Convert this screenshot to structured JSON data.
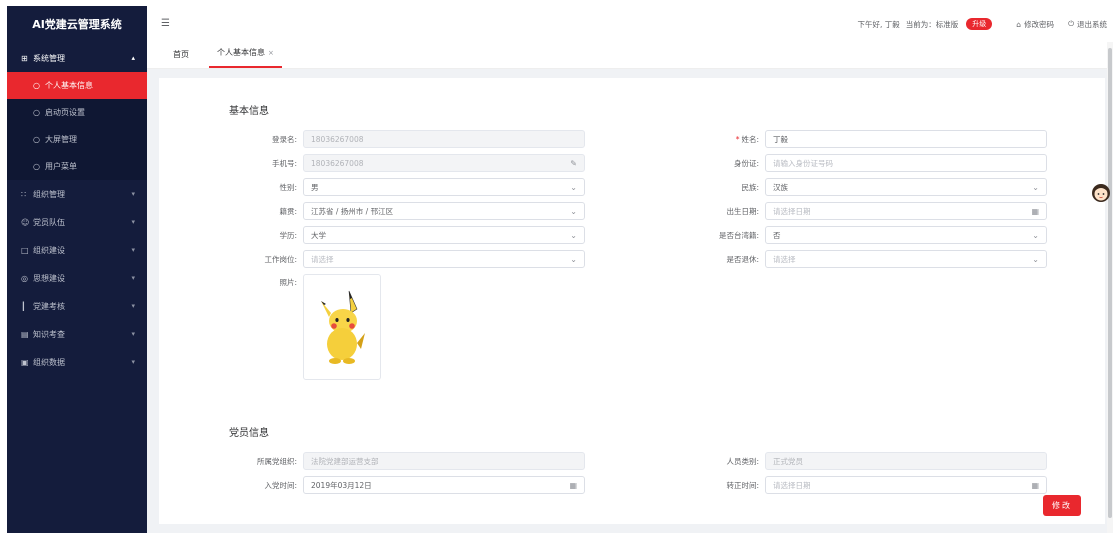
{
  "app": {
    "title": "AI党建云管理系统"
  },
  "sidebar": {
    "groups": [
      {
        "label": "系统管理",
        "icon": "grid-icon",
        "open": true,
        "children": [
          {
            "label": "个人基本信息",
            "active": true
          },
          {
            "label": "启动页设置"
          },
          {
            "label": "大屏管理"
          },
          {
            "label": "用户菜单"
          }
        ]
      },
      {
        "label": "组织管理",
        "icon": "org-icon"
      },
      {
        "label": "党员队伍",
        "icon": "person-icon"
      },
      {
        "label": "组织建设",
        "icon": "doc-icon"
      },
      {
        "label": "思想建设",
        "icon": "globe-icon"
      },
      {
        "label": "党建考核",
        "icon": "bar-chart-icon"
      },
      {
        "label": "知识考查",
        "icon": "book-icon"
      },
      {
        "label": "组织数据",
        "icon": "data-icon"
      }
    ]
  },
  "header": {
    "greeting": "下午好, 丁毅",
    "version_prefix": "当前为：标准版",
    "upgrade": "升级",
    "change_password": "修改密码",
    "logout": "退出系统"
  },
  "tabs": [
    {
      "label": "首页"
    },
    {
      "label": "个人基本信息",
      "active": true,
      "close": "×"
    }
  ],
  "basic": {
    "title": "基本信息",
    "login_label": "登录名:",
    "login_value": "18036267008",
    "name_label": "姓名:",
    "name_value": "丁毅",
    "phone_label": "手机号:",
    "phone_value": "18036267008",
    "idcard_label": "身份证:",
    "idcard_placeholder": "请输入身份证号码",
    "gender_label": "性别:",
    "gender_value": "男",
    "ethnic_label": "民族:",
    "ethnic_value": "汉族",
    "native_label": "籍贯:",
    "native_value": "江苏省 / 扬州市 / 邗江区",
    "birth_label": "出生日期:",
    "birth_placeholder": "请选择日期",
    "edu_label": "学历:",
    "edu_value": "大学",
    "taiwan_label": "是否台湾籍:",
    "taiwan_value": "否",
    "job_label": "工作岗位:",
    "job_placeholder": "请选择",
    "retired_label": "是否退休:",
    "retired_placeholder": "请选择",
    "photo_label": "照片:"
  },
  "party": {
    "title": "党员信息",
    "org_label": "所属党组织:",
    "org_value": "法院党建部运营支部",
    "type_label": "人员类别:",
    "type_value": "正式党员",
    "join_label": "入党时间:",
    "join_value": "2019年03月12日",
    "formal_label": "转正时间:",
    "formal_placeholder": "请选择日期"
  },
  "actions": {
    "edit": "修改"
  },
  "colors": {
    "sidebar_bg": "#141c3c",
    "accent": "#e9282e",
    "content_bg": "#f0f2f5"
  }
}
